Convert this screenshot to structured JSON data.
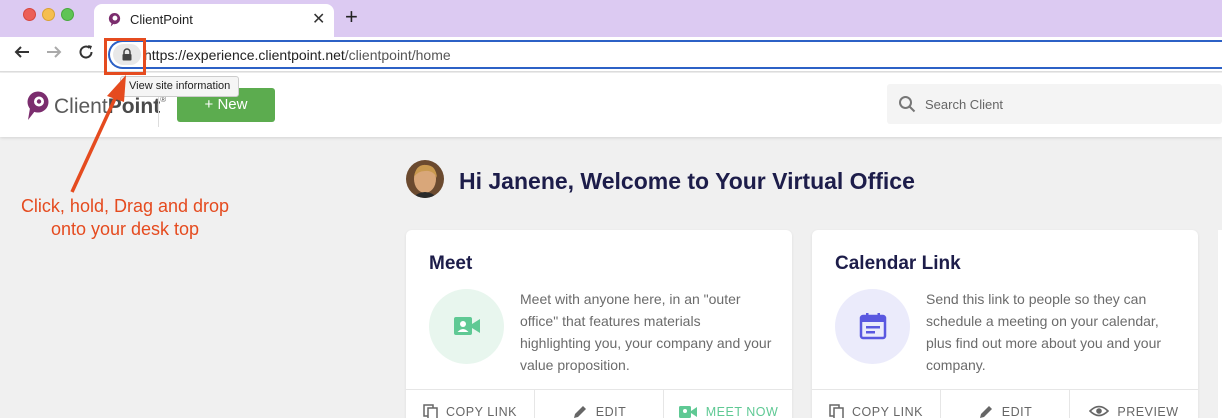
{
  "browser": {
    "tab_title": "ClientPoint",
    "tab_close": "✕",
    "new_tab": "+",
    "url_host": "https://experience.clientpoint.net",
    "url_path": "/clientpoint/home",
    "tooltip": "View site information"
  },
  "app": {
    "logo_text_light": "Client",
    "logo_text_bold": "Point",
    "logo_reg": "®",
    "new_button": "+ New",
    "search_placeholder": "Search Client"
  },
  "main": {
    "welcome": "Hi Janene, Welcome to Your Virtual Office",
    "annotation": "Click, hold, Drag and drop onto your desk top"
  },
  "cards": [
    {
      "title": "Meet",
      "icon": "video-camera-icon",
      "description": "Meet with anyone here, in an \"outer office\" that features materials highlighting you, your company and your value proposition.",
      "actions": [
        "COPY LINK",
        "EDIT",
        "MEET NOW"
      ]
    },
    {
      "title": "Calendar Link",
      "icon": "calendar-icon",
      "description": "Send this link to people so they can schedule a meeting on your calendar, plus find out more about you and your company.",
      "actions": [
        "COPY LINK",
        "EDIT",
        "PREVIEW"
      ]
    }
  ],
  "colors": {
    "tab_bar": "#dccaf2",
    "brand_purple": "#7b2d6e",
    "new_button_green": "#5cac4f",
    "heading_navy": "#1d1d4a",
    "annotation_red": "#e54b1f",
    "meet_green": "#5fc994",
    "calendar_blue": "#5a58e0"
  }
}
